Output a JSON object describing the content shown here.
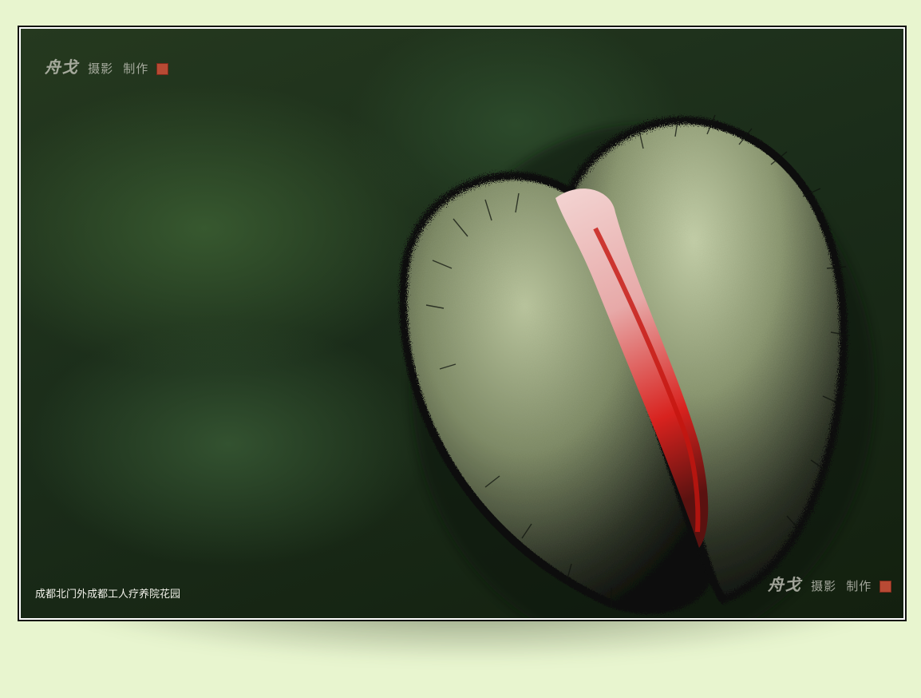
{
  "watermark_top": {
    "brand": "舟戈",
    "text1": "摄影",
    "text2": "制作"
  },
  "watermark_bottom": {
    "brand": "舟戈",
    "text1": "摄影",
    "text2": "制作"
  },
  "caption": "成都北门外成都工人疗养院花园",
  "colors": {
    "page_background": "#e8f5cf",
    "bud_green": "#aab58f",
    "petal_red": "#d61b1b",
    "background_green": "#22361f"
  }
}
